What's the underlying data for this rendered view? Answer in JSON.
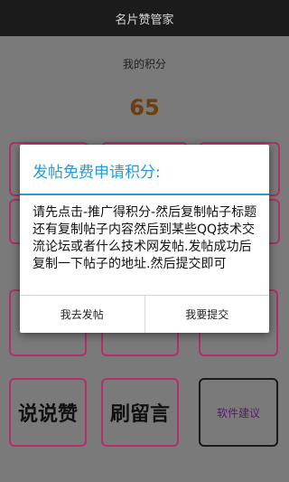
{
  "titlebar": {
    "title": "名片赞管家"
  },
  "points": {
    "label": "我的积分",
    "value": "65"
  },
  "tiles": {
    "shuoshuo": "说说赞",
    "liuyan": "刷留言",
    "feedback": "软件建议"
  },
  "dialog": {
    "title": "发帖免费申请积分:",
    "body": "请先点击-推广得积分-然后复制帖子标题还有复制帖子内容然后到某些QQ技术交流论坛或者什么技术网发帖.发帖成功后复制一下帖子的地址.然后提交即可",
    "btn_post": "我去发帖",
    "btn_submit": "我要提交"
  },
  "colors": {
    "accent": "#2a9ad6",
    "tile_border": "#b0306a",
    "points": "#6b3f10"
  }
}
